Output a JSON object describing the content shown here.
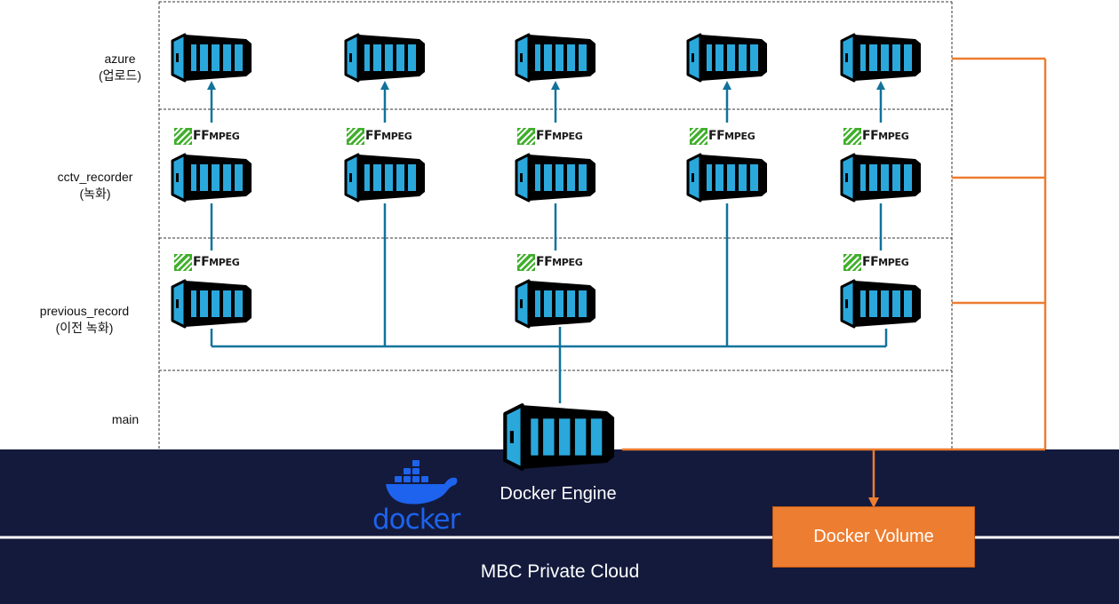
{
  "rows": [
    {
      "name": "azure",
      "sub": "(업로드)"
    },
    {
      "name": "cctv_recorder",
      "sub": "(녹화)"
    },
    {
      "name": "previous_record",
      "sub": "(이전 녹화)"
    },
    {
      "name": "main"
    }
  ],
  "ffmpeg": {
    "prefix": "FF",
    "suffix": "MPEG"
  },
  "docker": {
    "wordmark": "docker",
    "engine_label": "Docker Engine"
  },
  "volume_label": "Docker Volume",
  "cloud_label": "MBC Private Cloud",
  "colors": {
    "navy": "#141a3c",
    "orange": "#ed7d31",
    "teal": "#11739b",
    "container_blue": "#2aa8dc",
    "docker_blue": "#1d63ed",
    "ffmpeg_green": "#3fae2a"
  }
}
